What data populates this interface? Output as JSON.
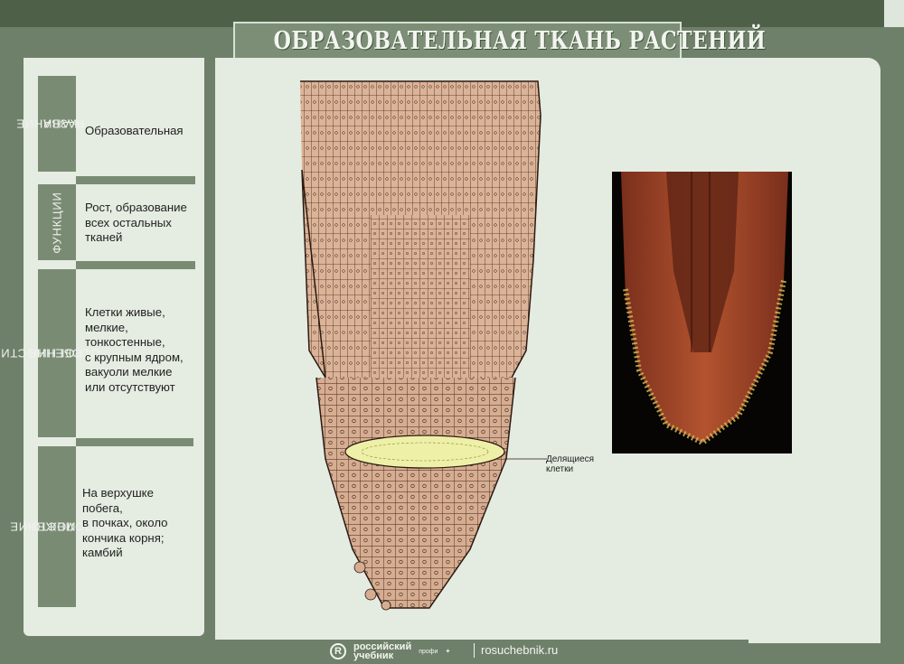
{
  "title": "ОБРАЗОВАТЕЛЬНАЯ ТКАНЬ РАСТЕНИЙ",
  "sections": [
    {
      "tab_lines": [
        "НАЗВАНИЕ",
        "ТКАНИ"
      ],
      "text": "Образовательная"
    },
    {
      "tab_lines": [
        "ФУНКЦИИ"
      ],
      "text_lines": [
        "Рост, образование",
        "всех остальных",
        "тканей"
      ]
    },
    {
      "tab_lines": [
        "ОСОБЕННОСТИ",
        "СТРОЕНИЯ"
      ],
      "text_lines": [
        "Клетки живые,",
        "мелкие,",
        "тонкостенные,",
        "с крупным ядром,",
        "вакуоли мелкие",
        "или отсутствуют"
      ]
    },
    {
      "tab_lines": [
        "МЕСТО-",
        "РАСПОЛОЖЕНИЕ"
      ],
      "text_lines": [
        "На верхушке",
        "побега,",
        "в почках, около",
        "кончика корня;",
        "камбий"
      ]
    }
  ],
  "callout": {
    "line1": "Делящиеся",
    "line2": "клетки"
  },
  "footer": {
    "logo_line1": "российский",
    "logo_line2": "учебник",
    "logo_small": "профи",
    "site": "rosuchebnik.ru"
  },
  "colors": {
    "frame": "#6f806a",
    "panel": "#e4ebe1",
    "tab": "#7a8b74",
    "cell_fill": "#dcb397",
    "meristem": "#eef0a8",
    "photo_tissue": "#a8452a"
  },
  "icons": [
    "publisher-logo-icon",
    "mascot-icon"
  ]
}
